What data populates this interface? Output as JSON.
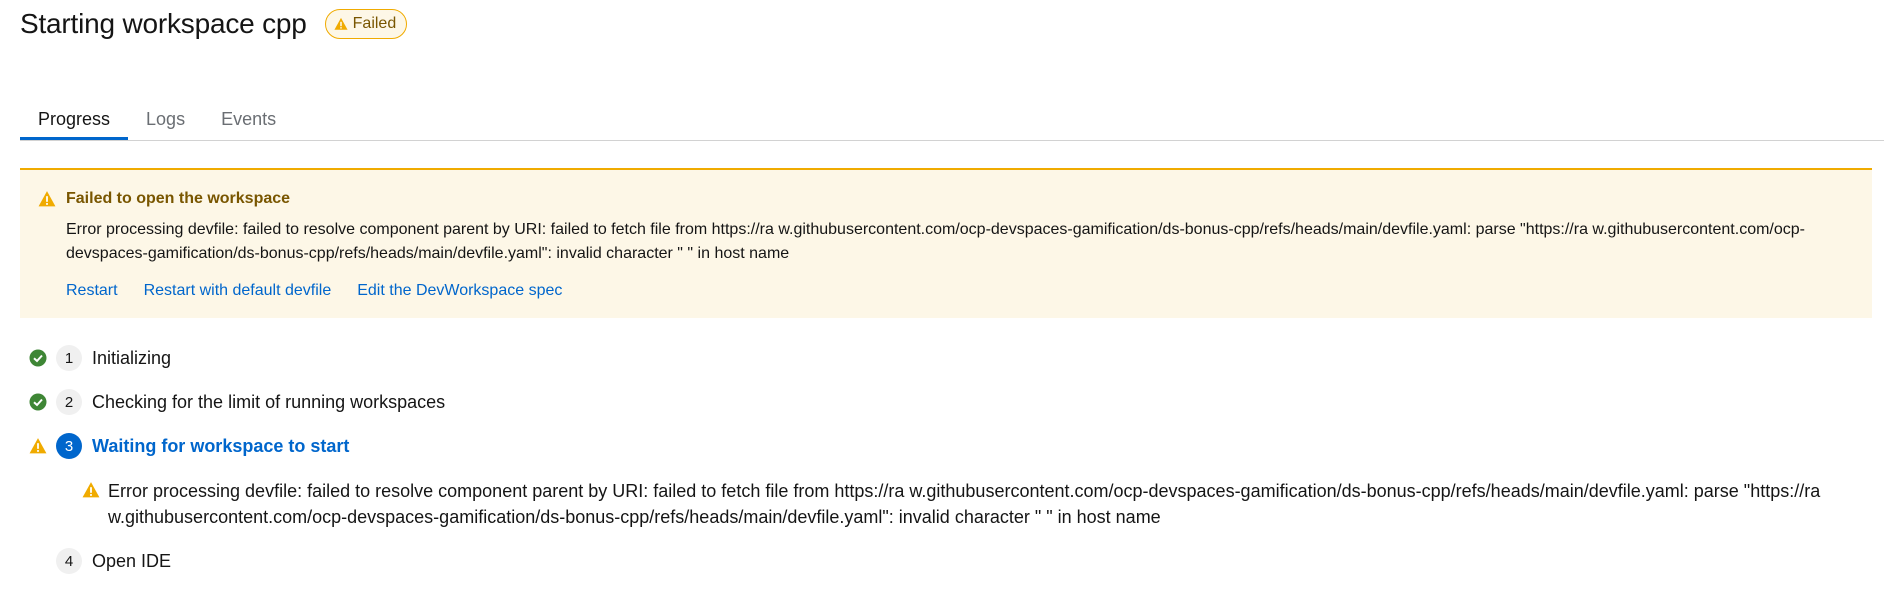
{
  "header": {
    "title": "Starting workspace cpp",
    "status_badge": "Failed",
    "status_color": "#f0ab00"
  },
  "tabs": [
    {
      "label": "Progress",
      "active": true
    },
    {
      "label": "Logs",
      "active": false
    },
    {
      "label": "Events",
      "active": false
    }
  ],
  "alert": {
    "icon": "warning-triangle-icon",
    "title": "Failed to open the workspace",
    "message": "Error processing devfile: failed to resolve component parent by URI: failed to fetch file from https://ra w.githubusercontent.com/ocp-devspaces-gamification/ds-bonus-cpp/refs/heads/main/devfile.yaml: parse \"https://ra w.githubusercontent.com/ocp-devspaces-gamification/ds-bonus-cpp/refs/heads/main/devfile.yaml\": invalid character \" \" in host name",
    "actions": [
      {
        "label": "Restart"
      },
      {
        "label": "Restart with default devfile"
      },
      {
        "label": "Edit the DevWorkspace spec"
      }
    ]
  },
  "steps": [
    {
      "number": "1",
      "label": "Initializing",
      "status": "done",
      "icon": "check-circle-icon"
    },
    {
      "number": "2",
      "label": "Checking for the limit of running workspaces",
      "status": "done",
      "icon": "check-circle-icon"
    },
    {
      "number": "3",
      "label": "Waiting for workspace to start",
      "status": "warning",
      "icon": "warning-triangle-icon",
      "error": "Error processing devfile: failed to resolve component parent by URI: failed to fetch file from https://ra w.githubusercontent.com/ocp-devspaces-gamification/ds-bonus-cpp/refs/heads/main/devfile.yaml: parse \"https://ra w.githubusercontent.com/ocp-devspaces-gamification/ds-bonus-cpp/refs/heads/main/devfile.yaml\": invalid character \" \" in host name"
    },
    {
      "number": "4",
      "label": "Open IDE",
      "status": "pending"
    }
  ],
  "colors": {
    "accent": "#0066cc",
    "success": "#3e8635",
    "warning": "#f0ab00"
  }
}
